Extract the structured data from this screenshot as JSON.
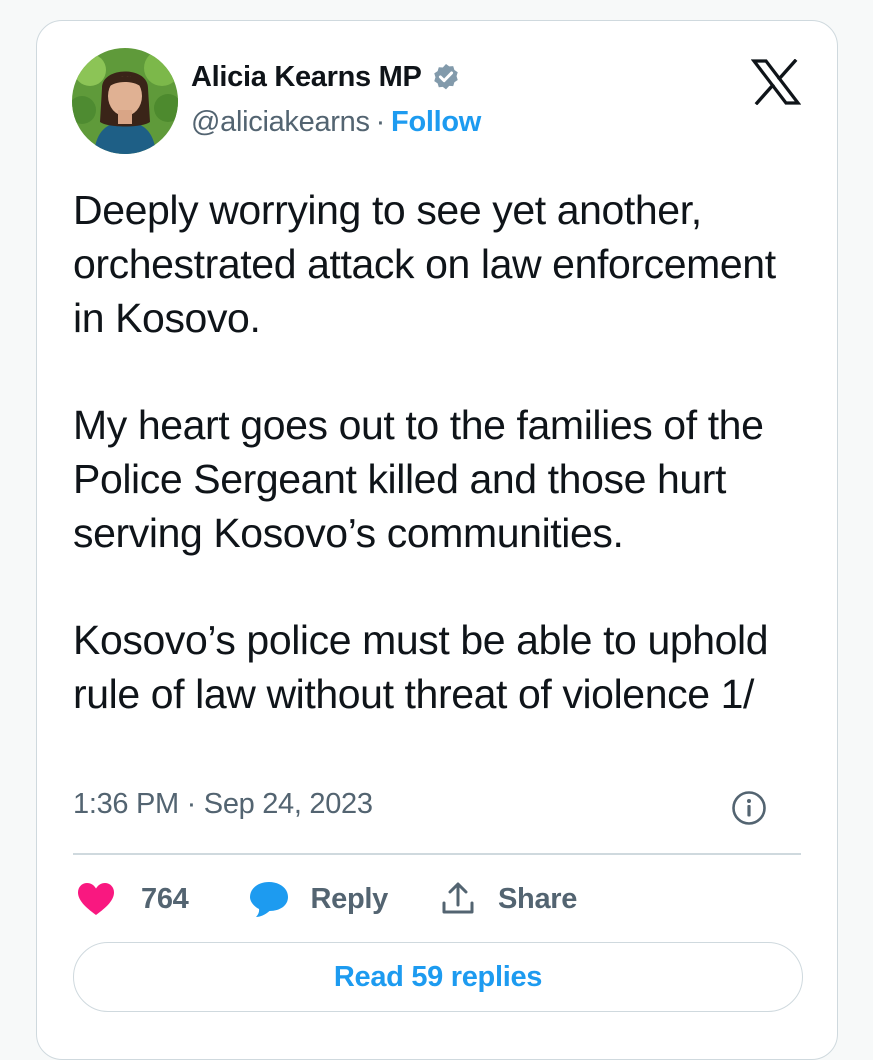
{
  "author": {
    "name": "Alicia Kearns MP",
    "handle": "@aliciakearns",
    "separator": "·",
    "follow_label": "Follow",
    "verified_color": "#829aab"
  },
  "tweet": {
    "paragraphs": [
      "Deeply worrying to see yet another, orchestrated attack on law enforcement in Kosovo.",
      "My heart goes out to the families of the Police Sergeant killed and those hurt serving Kosovo’s communities.",
      "Kosovo’s police must be able to uphold rule of law without threat of violence 1/"
    ],
    "timestamp": "1:36 PM · Sep 24, 2023"
  },
  "actions": {
    "like_count": "764",
    "reply_label": "Reply",
    "share_label": "Share"
  },
  "read_replies_label": "Read 59 replies",
  "icons": {
    "logo": "x-logo-icon",
    "verified": "verified-badge-icon",
    "info": "info-icon",
    "like": "heart-icon",
    "reply": "speech-bubble-icon",
    "share": "share-icon"
  },
  "colors": {
    "accent": "#1d9bf0",
    "like": "#f91880",
    "secondary_text": "#536471",
    "border": "#cfd9de"
  }
}
